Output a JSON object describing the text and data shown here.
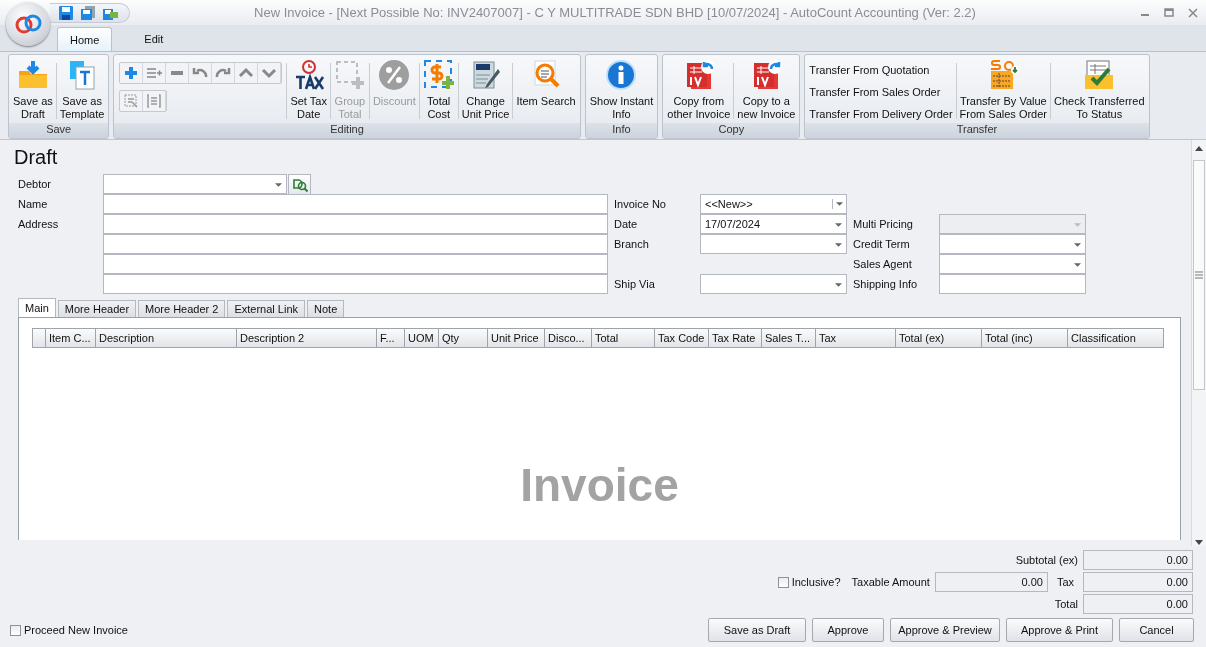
{
  "window": {
    "title": "New Invoice - [Next Possible No: INV2407007] - C Y MULTITRADE SDN BHD [10/07/2024] - AutoCount Accounting (Ver: 2.2)"
  },
  "ribbon_tabs": [
    {
      "label": "Home",
      "selected": true
    },
    {
      "label": "Edit",
      "selected": false
    }
  ],
  "ribbon_groups": [
    {
      "label": "Save",
      "items": [
        {
          "kind": "large",
          "lines": [
            "Save as",
            "Draft"
          ],
          "disabled": false
        },
        {
          "kind": "large",
          "lines": [
            "Save as",
            "Template"
          ],
          "disabled": false
        }
      ]
    },
    {
      "label": "Editing",
      "items": [
        {
          "kind": "toolbar"
        },
        {
          "kind": "large",
          "lines": [
            "Set Tax",
            "Date"
          ],
          "disabled": false
        },
        {
          "kind": "large",
          "lines": [
            "Group",
            "Total"
          ],
          "disabled": true
        },
        {
          "kind": "large",
          "lines": [
            "Discount"
          ],
          "disabled": true
        },
        {
          "kind": "large",
          "lines": [
            "Total",
            "Cost"
          ],
          "disabled": false
        },
        {
          "kind": "large",
          "lines": [
            "Change",
            "Unit Price"
          ],
          "disabled": false
        },
        {
          "kind": "large",
          "lines": [
            "Item Search"
          ],
          "disabled": false
        }
      ]
    },
    {
      "label": "Info",
      "items": [
        {
          "kind": "large",
          "lines": [
            "Show Instant",
            "Info"
          ],
          "disabled": false
        }
      ]
    },
    {
      "label": "Copy",
      "items": [
        {
          "kind": "large",
          "lines": [
            "Copy from",
            "other Invoice"
          ],
          "disabled": false
        },
        {
          "kind": "large",
          "lines": [
            "Copy to a",
            "new Invoice"
          ],
          "disabled": false
        }
      ]
    },
    {
      "label": "Transfer",
      "items": [
        {
          "kind": "stack",
          "entries": [
            {
              "label": "Transfer From Quotation"
            },
            {
              "label": "Transfer From Sales Order"
            },
            {
              "label": "Transfer From Delivery Order"
            }
          ]
        },
        {
          "kind": "large",
          "lines": [
            "Transfer By Value",
            "From Sales Order"
          ],
          "disabled": false
        },
        {
          "kind": "large",
          "lines": [
            "Check Transferred",
            "To Status"
          ],
          "disabled": false
        }
      ]
    }
  ],
  "heading": "Draft",
  "debtor_fields": [
    {
      "label": "Debtor",
      "kind": "lookup"
    },
    {
      "label": "Name",
      "kind": "text"
    },
    {
      "label": "Address",
      "kind": "text"
    },
    {
      "kind": "text"
    },
    {
      "kind": "text"
    },
    {
      "kind": "text"
    }
  ],
  "document_fields": [
    {
      "label": "Invoice No",
      "kind": "combo",
      "value": "<<New>>",
      "disabled": false
    },
    {
      "label": "Date",
      "kind": "combo",
      "value": "17/07/2024",
      "disabled": false
    },
    {
      "label": "Branch",
      "kind": "combo",
      "disabled": false
    },
    {
      "kind": "empty"
    },
    {
      "label": "Ship Via",
      "kind": "combo",
      "disabled": false
    }
  ],
  "extra_fields": [
    {
      "label": "Multi Pricing",
      "kind": "combo",
      "disabled": true
    },
    {
      "label": "Credit Term",
      "kind": "combo",
      "disabled": false
    },
    {
      "label": "Sales Agent",
      "kind": "combo",
      "disabled": false
    },
    {
      "label": "Shipping Info",
      "kind": "text",
      "disabled": false
    }
  ],
  "detail_tabs": [
    {
      "label": "Main",
      "selected": true
    },
    {
      "label": "More Header",
      "selected": false
    },
    {
      "label": "More Header 2",
      "selected": false
    },
    {
      "label": "External Link",
      "selected": false
    },
    {
      "label": "Note",
      "selected": false
    }
  ],
  "grid": {
    "columns": [
      "Item C...",
      "Description",
      "Description 2",
      "F...",
      "UOM",
      "Qty",
      "Unit Price",
      "Disco...",
      "Total",
      "Tax Code",
      "Tax Rate",
      "Sales T...",
      "Tax",
      "Total (ex)",
      "Total (inc)",
      "Classification"
    ],
    "empty_text": "Invoice"
  },
  "totals": {
    "subtotal_label": "Subtotal (ex)",
    "subtotal": "0.00",
    "inclusive": {
      "label": "Inclusive?",
      "checked": false
    },
    "taxable_label": "Taxable Amount",
    "taxable": "0.00",
    "tax_label": "Tax",
    "tax": "0.00",
    "total_label": "Total",
    "total": "0.00"
  },
  "proceed_new": {
    "label": "Proceed New Invoice",
    "checked": false
  },
  "buttons": [
    "Save as Draft",
    "Approve",
    "Approve & Preview",
    "Approve & Print",
    "Cancel"
  ]
}
